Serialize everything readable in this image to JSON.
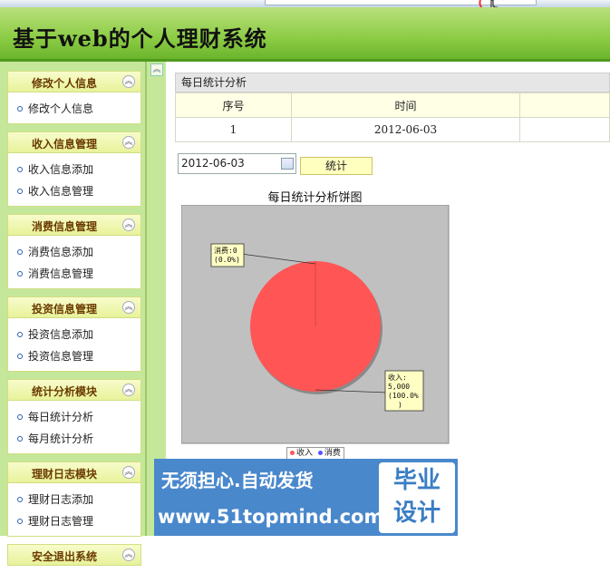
{
  "app": {
    "title": "基于web的个人理财系统"
  },
  "sidebar": {
    "groups": [
      {
        "title": "修改个人信息",
        "items": [
          "修改个人信息"
        ]
      },
      {
        "title": "收入信息管理",
        "items": [
          "收入信息添加",
          "收入信息管理"
        ]
      },
      {
        "title": "消费信息管理",
        "items": [
          "消费信息添加",
          "消费信息管理"
        ]
      },
      {
        "title": "投资信息管理",
        "items": [
          "投资信息添加",
          "投资信息管理"
        ]
      },
      {
        "title": "统计分析模块",
        "items": [
          "每日统计分析",
          "每月统计分析"
        ]
      },
      {
        "title": "理财日志模块",
        "items": [
          "理财日志添加",
          "理财日志管理"
        ]
      },
      {
        "title": "安全退出系统",
        "items": []
      }
    ],
    "collapse_glyph": "︽"
  },
  "main": {
    "panel_title": "每日统计分析",
    "table": {
      "headers": [
        "序号",
        "时间",
        ""
      ],
      "rows": [
        [
          "1",
          "2012-06-03",
          ""
        ]
      ]
    },
    "date_value": "2012-06-03",
    "stat_button": "统计"
  },
  "chart_data": {
    "type": "pie",
    "title": "每日统计分析饼图",
    "slices": [
      {
        "name": "收入",
        "value": 5000,
        "label_line1": "收入:",
        "label_line2": "5,000",
        "label_line3": "(100.0%",
        "label_line4": ")",
        "color": "#ff5555"
      },
      {
        "name": "消费",
        "value": 0,
        "label_line1": "消费:0",
        "label_line2": "(0.0%)",
        "color": "#5555ff"
      }
    ],
    "legend": [
      "收入",
      "消费"
    ],
    "background": "#c0c0c0"
  },
  "watermark": {
    "line1": "无须担心.自动发货",
    "line2": "www.51topmind.com",
    "box_line1": "毕业",
    "box_line2": "设计"
  },
  "colors": {
    "header_green": "#8ccc45",
    "menu_head": "#e8f29a",
    "pie_income": "#ff5555",
    "pie_expense": "#5555ff"
  }
}
